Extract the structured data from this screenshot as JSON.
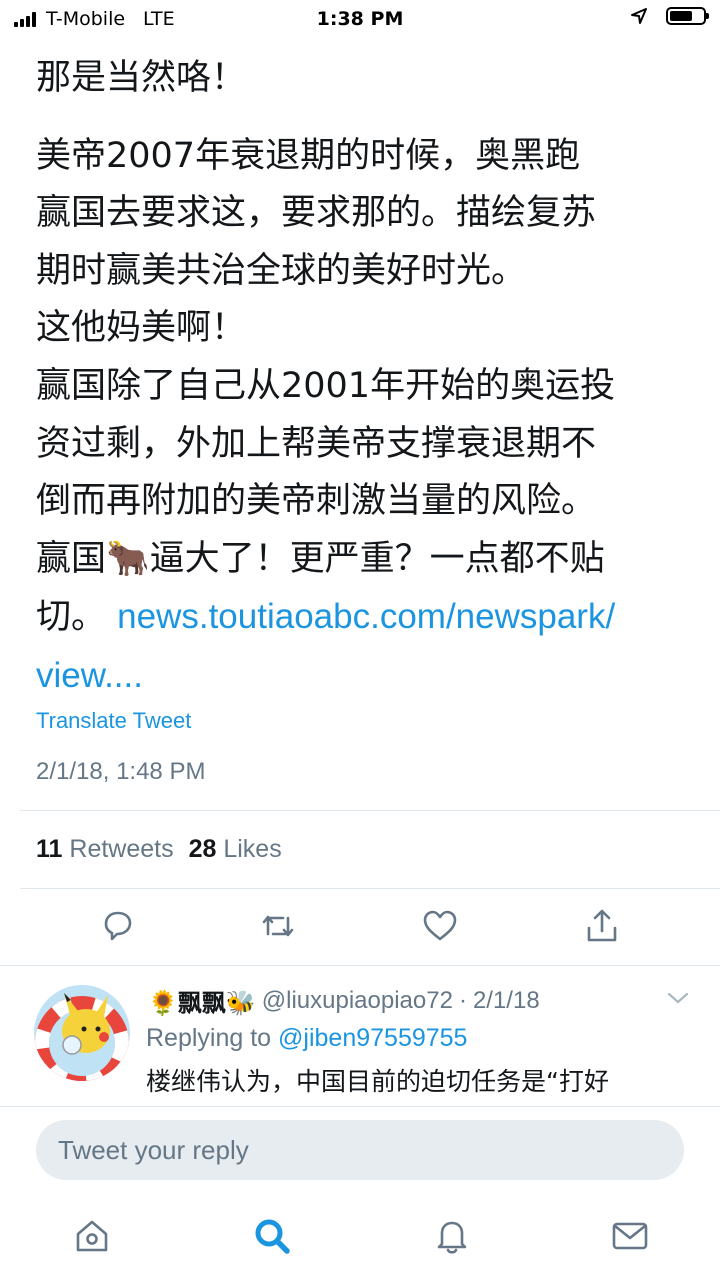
{
  "status_bar": {
    "carrier": "T-Mobile",
    "network": "LTE",
    "time": "1:38 PM"
  },
  "tweet": {
    "lines": [
      "那是当然咯！",
      "美帝2007年衰退期的时候，奥黑跑\n赢国去要求这，要求那的。描绘复苏\n期时赢美共治全球的美好时光。\n这他妈美啊！\n赢国除了自己从2001年开始的奥运投\n资过剩，外加上帮美帝支撑衰退期不\n倒而再附加的美帝刺激当量的风险。\n赢国🐂逼大了！更严重？一点都不贴\n切。"
    ],
    "link_text": "news.toutiaoabc.com/newspark/\nview....",
    "translate_label": "Translate Tweet",
    "timestamp": "2/1/18, 1:48 PM",
    "retweets_count": "11",
    "retweets_label": "Retweets",
    "likes_count": "28",
    "likes_label": "Likes"
  },
  "reply": {
    "display_name": "🌻飘飘🐝",
    "handle": "@liuxupiaopiao72",
    "separator": "·",
    "date": "2/1/18",
    "replying_to_label": "Replying to",
    "replying_to_handle": "@jiben97559755",
    "text": "楼继伟认为，中国目前的迫切任务是“打好"
  },
  "compose": {
    "placeholder": "Tweet your reply"
  },
  "tabs": {
    "items": [
      "home-icon",
      "search-icon",
      "notifications-icon",
      "messages-icon"
    ],
    "active": "search-icon"
  },
  "colors": {
    "accent": "#1b95e0",
    "muted": "#657786",
    "text": "#14171a",
    "compose_bg": "#e6ecf0"
  }
}
